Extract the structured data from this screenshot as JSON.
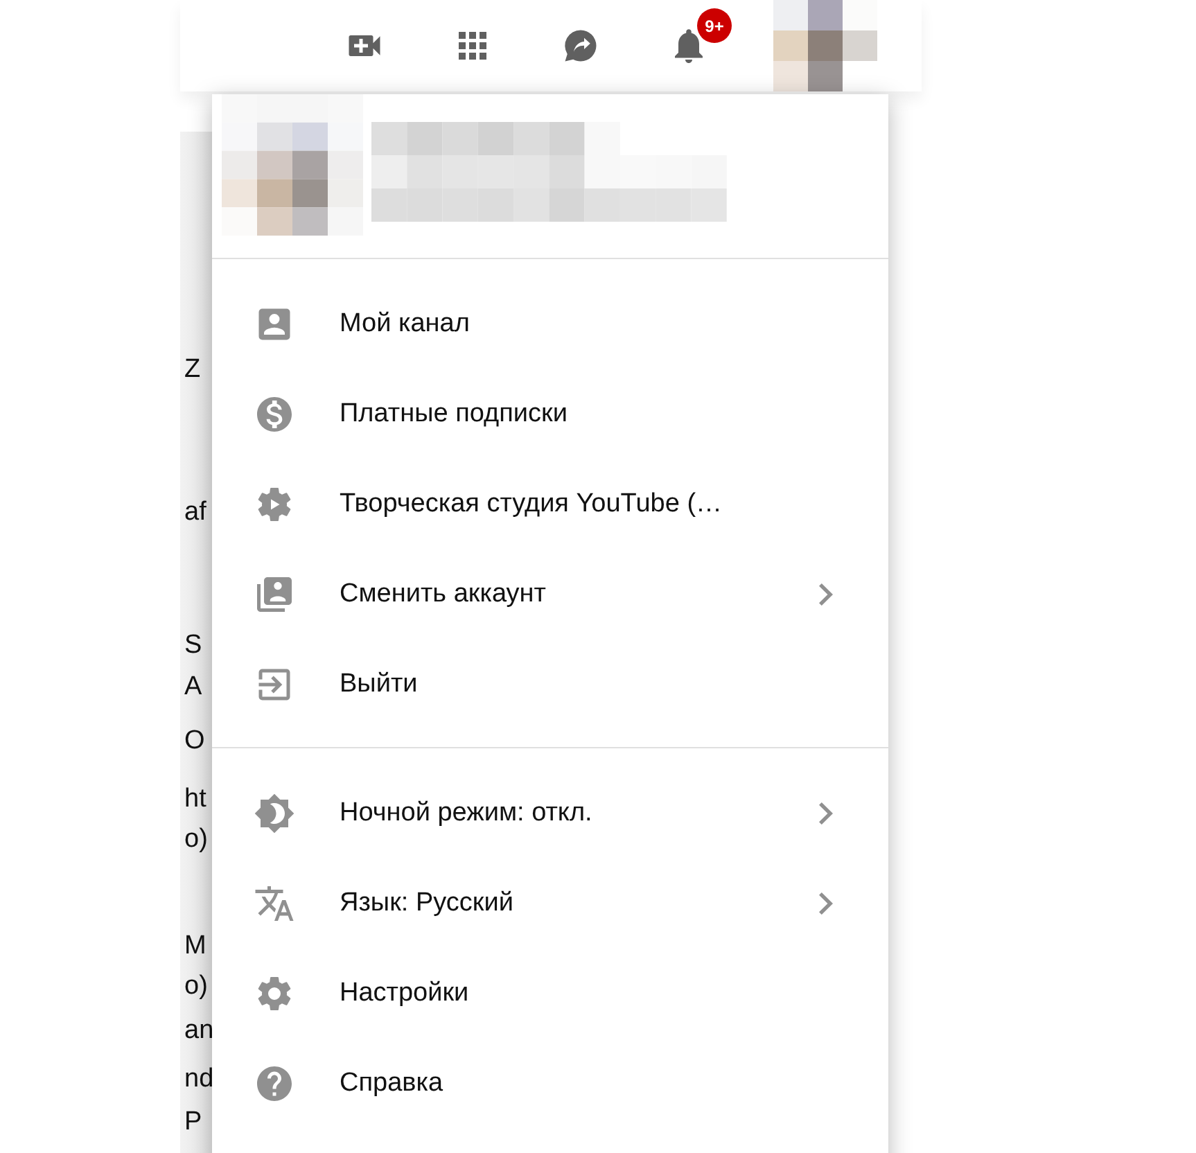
{
  "topbar": {
    "notification_badge": "9+"
  },
  "background_fragments": [
    "Z",
    "af",
    "S",
    "A",
    "O",
    "ht",
    "o)",
    "M",
    "o)",
    "an",
    "nd",
    "P"
  ],
  "menu": {
    "sections": [
      {
        "items": [
          {
            "kind": "channel",
            "label": "Мой канал",
            "has_submenu": false
          },
          {
            "kind": "paid",
            "label": "Платные подписки",
            "has_submenu": false
          },
          {
            "kind": "studio",
            "label": "Творческая студия YouTube (…",
            "has_submenu": false
          },
          {
            "kind": "switch",
            "label": "Сменить аккаунт",
            "has_submenu": true
          },
          {
            "kind": "exit",
            "label": "Выйти",
            "has_submenu": false
          }
        ]
      },
      {
        "items": [
          {
            "kind": "night",
            "label": "Ночной режим: откл.",
            "has_submenu": true
          },
          {
            "kind": "language",
            "label": "Язык: Русский",
            "has_submenu": true
          },
          {
            "kind": "settings",
            "label": "Настройки",
            "has_submenu": false
          },
          {
            "kind": "help",
            "label": "Справка",
            "has_submenu": false
          }
        ]
      }
    ]
  }
}
